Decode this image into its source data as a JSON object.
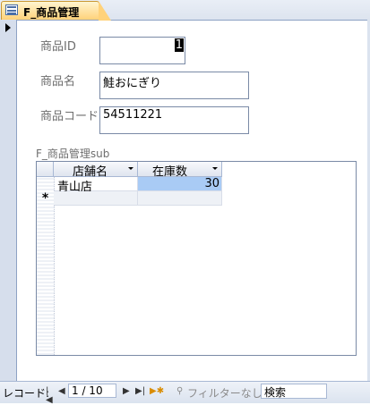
{
  "tab": {
    "title": "F_商品管理",
    "icon": "form-icon"
  },
  "form": {
    "id_label": "商品ID",
    "id_value": "1",
    "name_label": "商品名",
    "name_value": "鮭おにぎり",
    "code_label": "商品コード",
    "code_value": "54511221"
  },
  "subform": {
    "label": "F_商品管理sub",
    "columns": [
      "店舗名",
      "在庫数"
    ],
    "rows": [
      {
        "store": "青山店",
        "stock": "30"
      }
    ],
    "new_row_marker": "*"
  },
  "navbar": {
    "record_label": "レコード:",
    "record_value": "1 / 10",
    "filter_label": "フィルターなし",
    "search_placeholder": "検索"
  },
  "colors": {
    "tab": "#ffd27a",
    "selected_cell": "#a9cbf5"
  }
}
